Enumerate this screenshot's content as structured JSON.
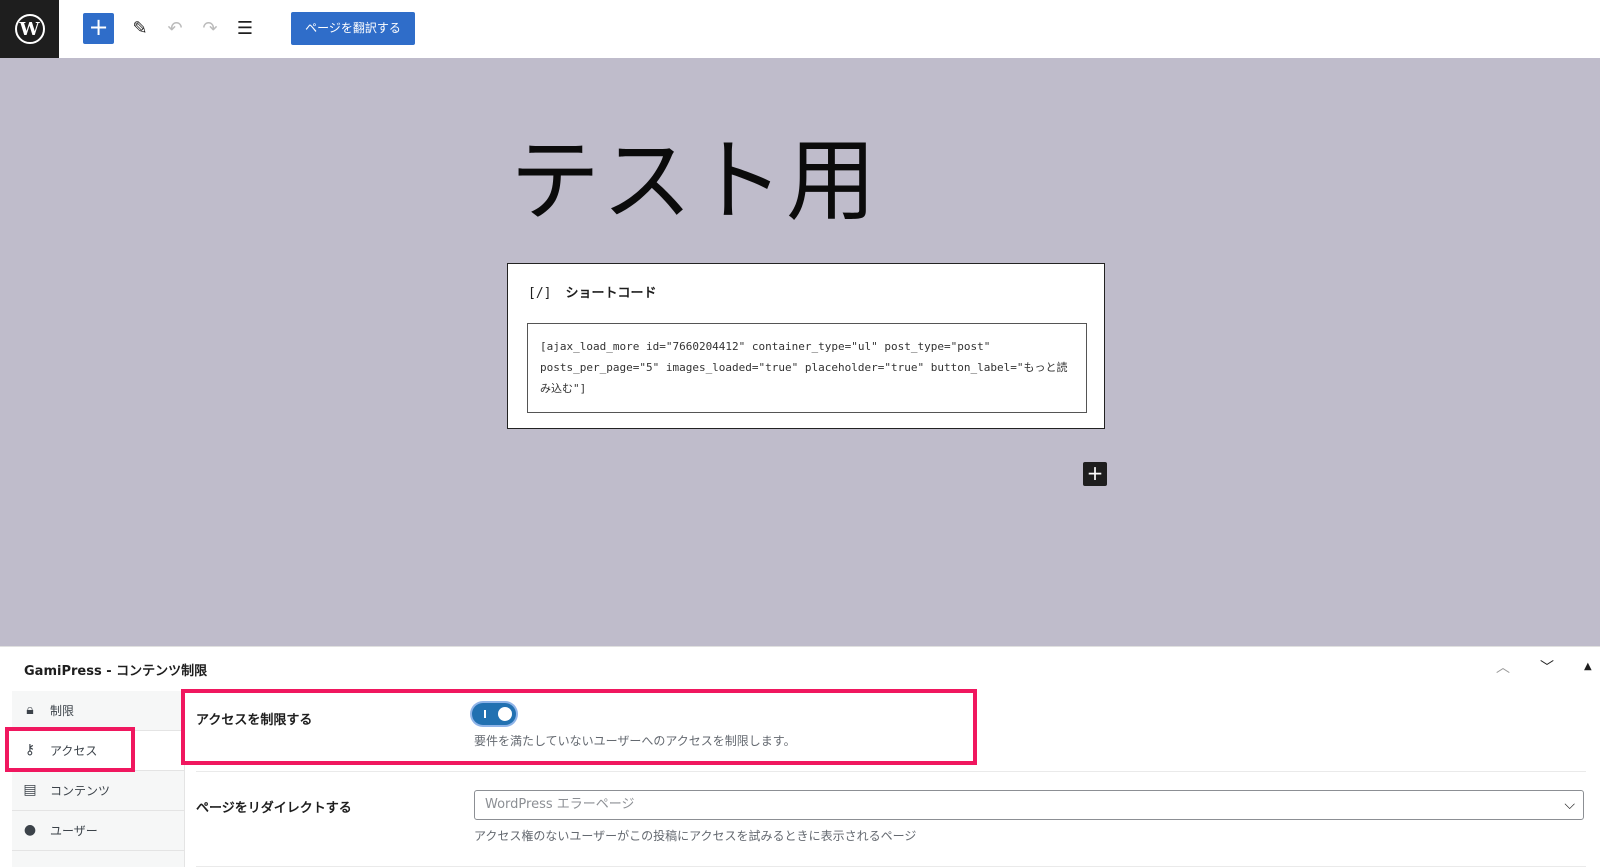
{
  "toolbar": {
    "add_label": "+",
    "translate_label": "ページを翻訳する"
  },
  "editor": {
    "post_title": "テスト用",
    "shortcode_block": {
      "icon_text": "[/]",
      "title": "ショートコード",
      "content": "[ajax_load_more id=\"7660204412\" container_type=\"ul\" post_type=\"post\" posts_per_page=\"5\" images_loaded=\"true\" placeholder=\"true\" button_label=\"もっと読み込む\"]"
    },
    "block_add_label": "+"
  },
  "metabox": {
    "title": "GamiPress - コンテンツ制限",
    "tabs": [
      {
        "label": "制限",
        "icon": "lock-icon"
      },
      {
        "label": "アクセス",
        "icon": "key-icon",
        "active": true
      },
      {
        "label": "コンテンツ",
        "icon": "content-icon"
      },
      {
        "label": "ユーザー",
        "icon": "user-icon"
      }
    ],
    "restrict_access": {
      "label": "アクセスを制限する",
      "enabled": true,
      "description": "要件を満たしていないユーザーへのアクセスを制限します。"
    },
    "redirect_page": {
      "label": "ページをリダイレクトする",
      "placeholder": "WordPress エラーページ",
      "description": "アクセス権のないユーザーがこの投稿にアクセスを試みるときに表示されるページ"
    }
  },
  "colors": {
    "canvas_bg": "#bfbccb",
    "accent": "#2f6dc9",
    "highlight": "#f0175f"
  }
}
